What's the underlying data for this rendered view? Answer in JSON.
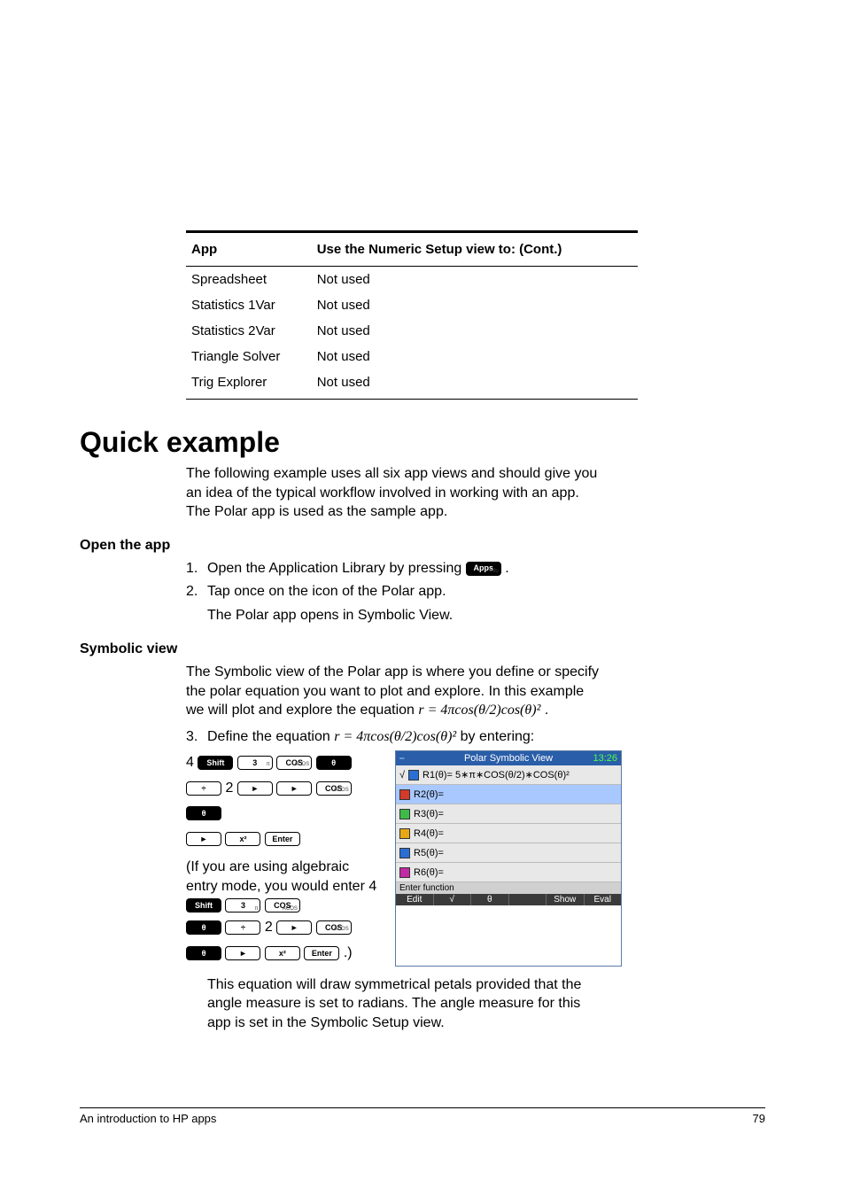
{
  "table": {
    "headers": [
      "App",
      "Use the Numeric Setup view to:  (Cont.)"
    ],
    "rows": [
      [
        "Spreadsheet",
        "Not used"
      ],
      [
        "Statistics 1Var",
        "Not used"
      ],
      [
        "Statistics 2Var",
        "Not used"
      ],
      [
        "Triangle Solver",
        "Not used"
      ],
      [
        "Trig Explorer",
        "Not used"
      ]
    ]
  },
  "section_title": "Quick example",
  "intro_para": "The following example uses all six app views and should give you an idea of the typical workflow involved in working with an app. The Polar app is used as the sample app.",
  "open_heading": "Open the app",
  "step1_pre": "Open the Application Library by pressing ",
  "step1_post": ".",
  "apps_key": "Apps",
  "apps_key_sub": "Info",
  "step2": "Tap once on the icon of the Polar app.",
  "step2_follow": "The Polar app opens in Symbolic View.",
  "symbolic_heading": "Symbolic view",
  "symbolic_para": "The Symbolic view of the Polar app is where you define or specify the polar equation you want to plot and explore. In this example we will plot and explore the equation ",
  "equation_inline": "r = 4πcos(θ/2)cos(θ)²",
  "symbolic_para_end": ".",
  "step3_pre": "Define the equation ",
  "step3_post": " by entering:",
  "keyseq_line1_prefix": "4",
  "keyseq_note": "(If you are using algebraic entry mode, you would enter 4",
  "keyseq_note_end": ".)",
  "keys": {
    "shift": "Shift",
    "three": "3",
    "three_sub": "π",
    "cos": "COS",
    "cos_sub": "ACOS",
    "theta": "θ",
    "div": "÷",
    "two_prefix": "2",
    "right": "►",
    "xsq": "x²",
    "enter": "Enter"
  },
  "screenshot": {
    "title": "Polar Symbolic View",
    "time": "13:26",
    "r1": "R1(θ)= 5∗π∗COS(θ/2)∗COS(θ)²",
    "rows": [
      "R2(θ)=",
      "R3(θ)=",
      "R4(θ)=",
      "R5(θ)=",
      "R6(θ)="
    ],
    "colors": [
      "#d43a2a",
      "#3dbb49",
      "#e6a817",
      "#2a6fd4",
      "#c22aa4"
    ],
    "status": "Enter function",
    "softkeys": [
      "Edit",
      "√",
      "θ",
      "",
      "Show",
      "Eval"
    ]
  },
  "after_para": "This equation will draw symmetrical petals provided that the angle measure is set to radians. The angle measure for this app is set in the Symbolic Setup view.",
  "footer_left": "An introduction to HP apps",
  "footer_right": "79"
}
